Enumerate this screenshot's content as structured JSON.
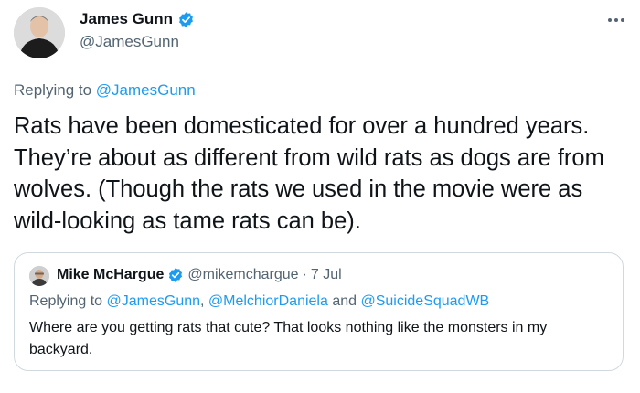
{
  "author": {
    "name": "James Gunn",
    "handle": "@JamesGunn",
    "verified": true,
    "avatar_icon": "profile-photo"
  },
  "menu_icon": "more-horizontal-icon",
  "replying": {
    "prefix": "Replying to ",
    "mention": "@JamesGunn"
  },
  "tweet_text": "Rats have been domesticated for over a hundred years. They’re about as different from wild rats as dogs are from wolves. (Though the rats we used in the movie were as wild-looking as tame rats can be).",
  "quote": {
    "name": "Mike McHargue",
    "handle": "@mikemchargue",
    "separator": "·",
    "date": "7 Jul",
    "verified": true,
    "replying_prefix": "Replying to ",
    "mentions": [
      "@JamesGunn",
      "@MelchiorDaniela",
      "@SuicideSquadWB"
    ],
    "mention_sep_1": ", ",
    "mention_sep_2": " and ",
    "text": "Where are you getting rats that cute? That looks nothing like the monsters in my backyard."
  },
  "colors": {
    "link": "#1d9bf0",
    "secondary_text": "#536471",
    "border": "#cfd9de",
    "verified": "#1d9bf0"
  }
}
